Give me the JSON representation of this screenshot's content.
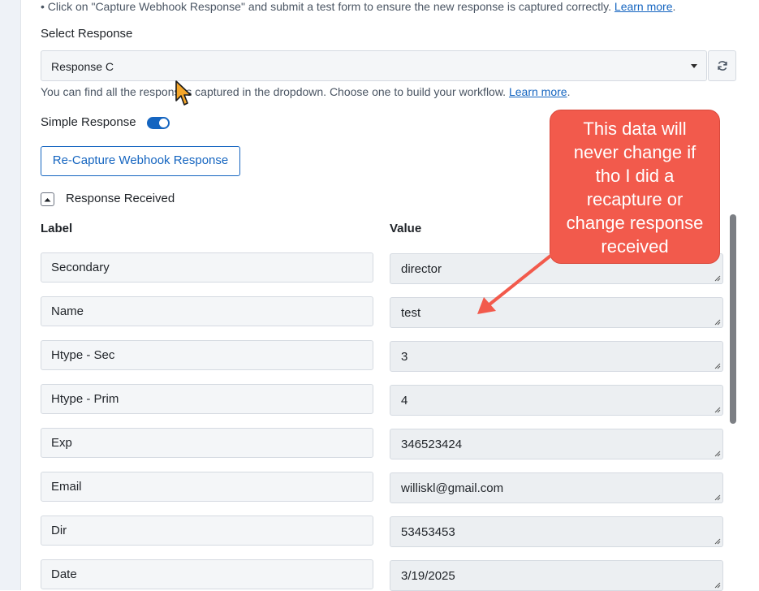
{
  "tip": {
    "text": "• Click on \"Capture Webhook Response\" and submit a test form to ensure the new response is captured correctly.",
    "link": "Learn more",
    "end": "."
  },
  "select_response": {
    "label": "Select Response",
    "value": "Response C"
  },
  "help": {
    "text": "You can find all the responses captured in the dropdown. Choose one to build your workflow.",
    "link": "Learn more",
    "end": "."
  },
  "simple_response": {
    "label": "Simple Response",
    "enabled": true
  },
  "recapture_button": "Re-Capture Webhook Response",
  "response_received": {
    "label": "Response Received",
    "col_label": "Label",
    "col_value": "Value",
    "rows": [
      {
        "label": "Secondary",
        "value": "director"
      },
      {
        "label": "Name",
        "value": "test"
      },
      {
        "label": "Htype - Sec",
        "value": "3"
      },
      {
        "label": "Htype - Prim",
        "value": "4"
      },
      {
        "label": "Exp",
        "value": "346523424"
      },
      {
        "label": "Email",
        "value": "williskl@gmail.com"
      },
      {
        "label": "Dir",
        "value": "53453453"
      },
      {
        "label": "Date",
        "value": "3/19/2025"
      }
    ]
  },
  "annotation": {
    "lines": [
      "This data will",
      "never change if",
      "tho I did a",
      "recapture or",
      "change response",
      "received"
    ]
  },
  "colors": {
    "accent": "#1565c0",
    "callout": "#f25a4c"
  },
  "icons": {
    "refresh": "refresh-icon",
    "caret": "chevron-down-icon",
    "collapse": "chevron-up-icon",
    "cursor": "mouse-pointer-icon"
  }
}
